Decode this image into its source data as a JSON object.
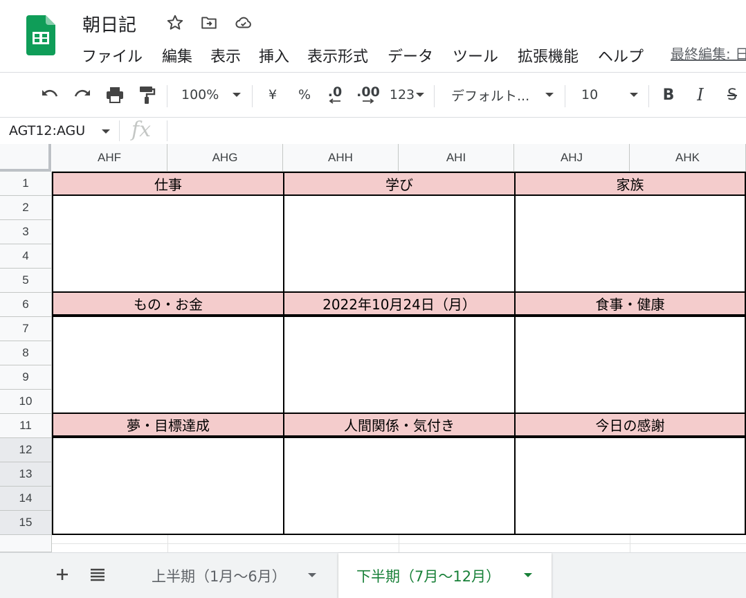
{
  "app": {
    "title": "朝日記",
    "last_edit": "最終編集: 日",
    "brand_color": "#0f9d58"
  },
  "menu": [
    "ファイル",
    "編集",
    "表示",
    "挿入",
    "表示形式",
    "データ",
    "ツール",
    "拡張機能",
    "ヘルプ"
  ],
  "toolbar": {
    "zoom": "100%",
    "currency": "¥",
    "percent": "%",
    "decrease_decimal": ".0",
    "increase_decimal": ".00",
    "more_formats": "123",
    "font": "デフォルト...",
    "font_size": "10",
    "bold": "B",
    "italic": "I",
    "strike": "S"
  },
  "formula_bar": {
    "name_box": "AGT12:AGU",
    "fx": "fx",
    "value": ""
  },
  "columns": [
    "AHF",
    "AHG",
    "AHH",
    "AHI",
    "AHJ",
    "AHK"
  ],
  "rows": [
    "1",
    "2",
    "3",
    "4",
    "5",
    "6",
    "7",
    "8",
    "9",
    "10",
    "11",
    "12",
    "13",
    "14",
    "15"
  ],
  "sections": [
    {
      "title": "仕事"
    },
    {
      "title": "学び"
    },
    {
      "title": "家族"
    },
    {
      "title": "もの・お金"
    },
    {
      "title": "2022年10月24日（月）"
    },
    {
      "title": "食事・健康"
    },
    {
      "title": "夢・目標達成"
    },
    {
      "title": "人間関係・気付き"
    },
    {
      "title": "今日の感謝"
    }
  ],
  "colors": {
    "header_fill": "#f4cccc",
    "active_tab": "#188038"
  },
  "sheets": [
    {
      "name": "上半期（1月～6月）",
      "active": false
    },
    {
      "name": "下半期（7月～12月）",
      "active": true
    }
  ]
}
